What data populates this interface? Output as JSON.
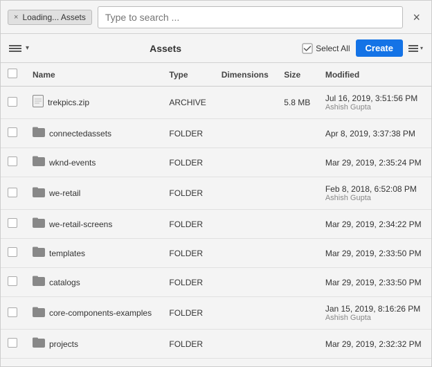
{
  "topbar": {
    "tab_label": "Loading... Assets",
    "close_tab_x": "×",
    "search_placeholder": "Type to search ...",
    "dialog_close": "×"
  },
  "toolbar": {
    "title": "Assets",
    "select_all_label": "Select All",
    "create_label": "Create"
  },
  "table": {
    "columns": [
      "",
      "Name",
      "Type",
      "Dimensions",
      "Size",
      "Modified"
    ],
    "rows": [
      {
        "icon": "file",
        "name": "trekpics.zip",
        "type": "ARCHIVE",
        "dimensions": "",
        "size": "5.8 MB",
        "modified_date": "Jul 16, 2019, 3:51:56 PM",
        "modified_user": "Ashish Gupta"
      },
      {
        "icon": "folder",
        "name": "connectedassets",
        "type": "FOLDER",
        "dimensions": "",
        "size": "",
        "modified_date": "Apr 8, 2019, 3:37:38 PM",
        "modified_user": ""
      },
      {
        "icon": "folder",
        "name": "wknd-events",
        "type": "FOLDER",
        "dimensions": "",
        "size": "",
        "modified_date": "Mar 29, 2019, 2:35:24 PM",
        "modified_user": ""
      },
      {
        "icon": "folder",
        "name": "we-retail",
        "type": "FOLDER",
        "dimensions": "",
        "size": "",
        "modified_date": "Feb 8, 2018, 6:52:08 PM",
        "modified_user": "Ashish Gupta"
      },
      {
        "icon": "folder",
        "name": "we-retail-screens",
        "type": "FOLDER",
        "dimensions": "",
        "size": "",
        "modified_date": "Mar 29, 2019, 2:34:22 PM",
        "modified_user": ""
      },
      {
        "icon": "folder",
        "name": "templates",
        "type": "FOLDER",
        "dimensions": "",
        "size": "",
        "modified_date": "Mar 29, 2019, 2:33:50 PM",
        "modified_user": ""
      },
      {
        "icon": "folder",
        "name": "catalogs",
        "type": "FOLDER",
        "dimensions": "",
        "size": "",
        "modified_date": "Mar 29, 2019, 2:33:50 PM",
        "modified_user": ""
      },
      {
        "icon": "folder",
        "name": "core-components-examples",
        "type": "FOLDER",
        "dimensions": "",
        "size": "",
        "modified_date": "Jan 15, 2019, 8:16:26 PM",
        "modified_user": "Ashish Gupta"
      },
      {
        "icon": "folder",
        "name": "projects",
        "type": "FOLDER",
        "dimensions": "",
        "size": "",
        "modified_date": "Mar 29, 2019, 2:32:32 PM",
        "modified_user": ""
      }
    ]
  }
}
